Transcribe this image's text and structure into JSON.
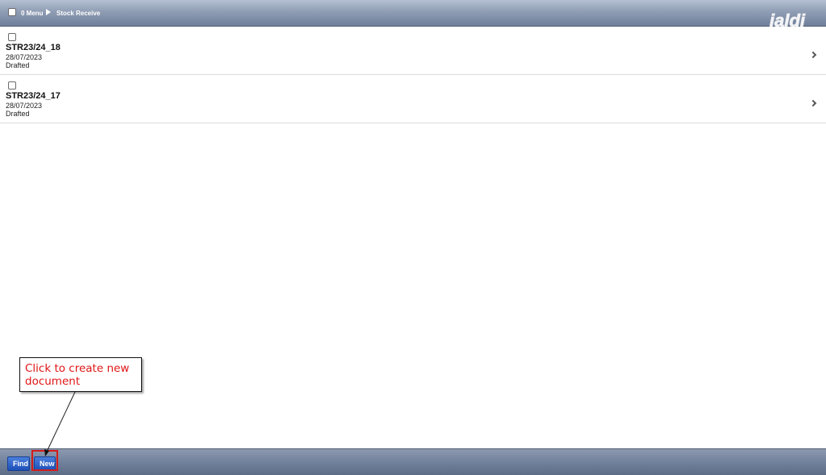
{
  "header": {
    "menu_label": "0 Menu",
    "breadcrumb": "Stock Receive",
    "logo_text": "jaldi"
  },
  "list": {
    "items": [
      {
        "title": "STR23/24_18",
        "date": "28/07/2023",
        "status": "Drafted"
      },
      {
        "title": "STR23/24_17",
        "date": "28/07/2023",
        "status": "Drafted"
      }
    ]
  },
  "footer": {
    "find_label": "Find",
    "new_label": "New"
  },
  "annotation": {
    "callout_text": "Click to create new document",
    "highlight_color": "#d41b1b"
  }
}
